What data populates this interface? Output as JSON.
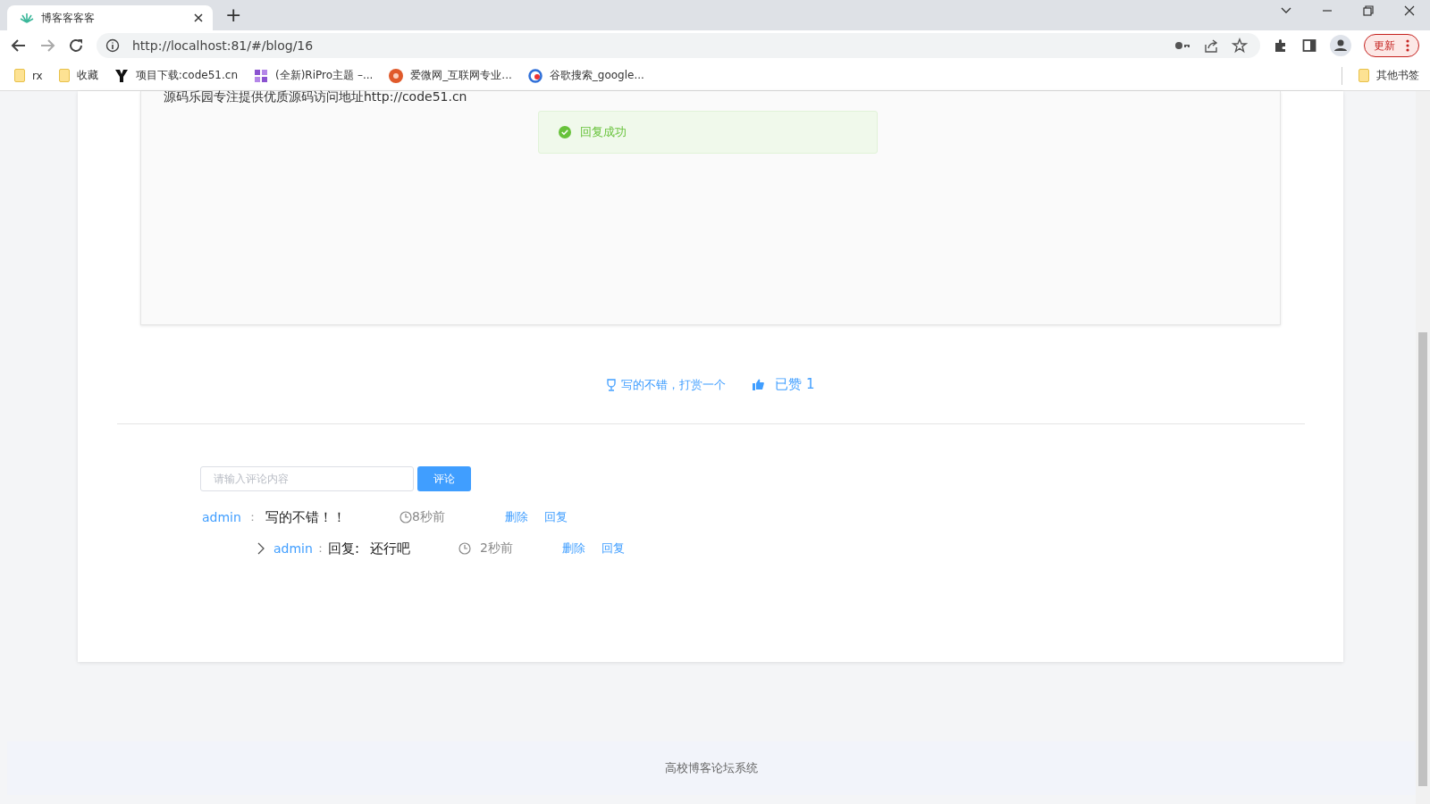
{
  "browser": {
    "tabs": [
      {
        "title": "博客客客客",
        "selected": true
      }
    ],
    "new_tab": "+",
    "url": "http://localhost:81/#/blog/16",
    "update_button": "更新",
    "bookmarks": [
      {
        "label": "rx",
        "kind": "folder"
      },
      {
        "label": "收藏",
        "kind": "folder"
      },
      {
        "label": "项目下载:code51.cn",
        "kind": "y"
      },
      {
        "label": "(全新)RiPro主题 –...",
        "kind": "zy"
      },
      {
        "label": "爱微网_互联网专业...",
        "kind": "ai"
      },
      {
        "label": "谷歌搜索_google...",
        "kind": "g"
      }
    ],
    "other_bookmarks": "其他书签"
  },
  "article": {
    "text": "源码乐园专注提供优质源码访问地址http://code51.cn"
  },
  "toast": {
    "message": "回复成功"
  },
  "actions": {
    "reward": "写的不错，打赏一个",
    "like": "已赞 1"
  },
  "comment_form": {
    "placeholder": "请输入评论内容",
    "button": "评论"
  },
  "comments": [
    {
      "user": "admin",
      "sep": "：",
      "text": "写的不错！！",
      "time": "8秒前",
      "delete": "删除",
      "reply": "回复",
      "children": [
        {
          "user": "admin",
          "sep": "：",
          "prefix": "回复:",
          "text": "还行吧",
          "time": "2秒前",
          "delete": "删除",
          "reply": "回复"
        }
      ]
    }
  ],
  "footer": "高校博客论坛系统"
}
